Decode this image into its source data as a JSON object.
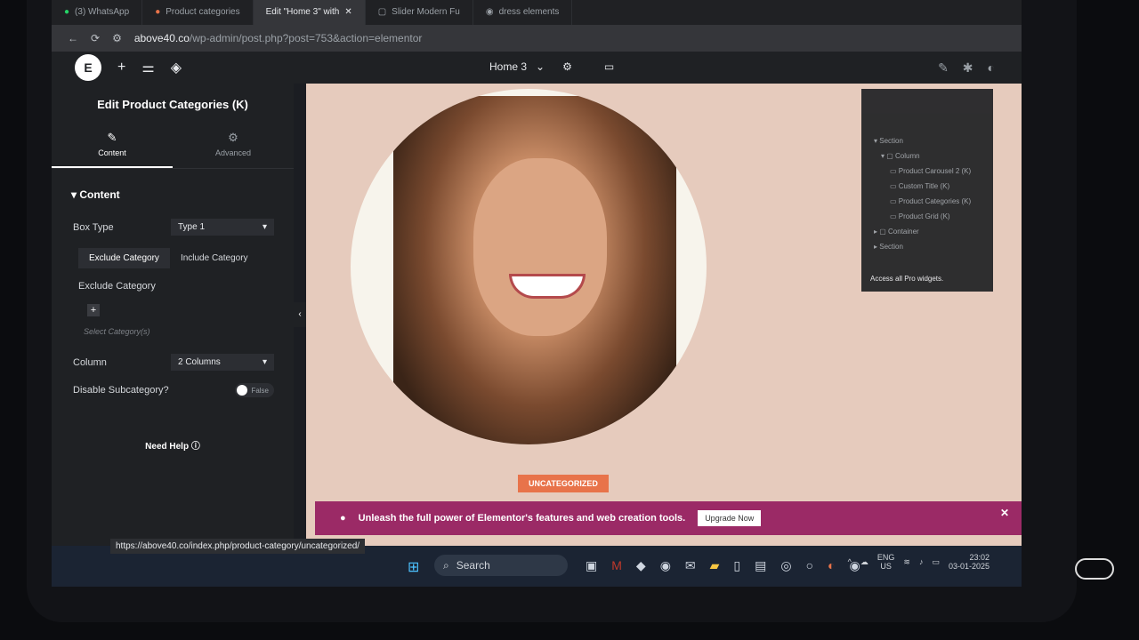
{
  "browser": {
    "tabs": [
      {
        "label": "(3) WhatsApp",
        "icon": "whatsapp-icon",
        "active": false
      },
      {
        "label": "Product categories",
        "icon": "chrome-icon",
        "active": false
      },
      {
        "label": "Edit \"Home 3\" with",
        "icon": "elementor-icon",
        "active": true
      },
      {
        "label": "Slider Modern Fu",
        "icon": "page-icon",
        "active": false
      },
      {
        "label": "dress elements",
        "icon": "google-icon",
        "active": false
      }
    ],
    "url_host": "above40.co",
    "url_path": "/wp-admin/post.php?post=753&action=elementor"
  },
  "topbar": {
    "page_name": "Home 3"
  },
  "panel": {
    "title": "Edit Product Categories (K)",
    "tab_content": "Content",
    "tab_advanced": "Advanced",
    "section": "Content",
    "box_type_label": "Box Type",
    "box_type_value": "Type 1",
    "exclude_btn": "Exclude Category",
    "include_btn": "Include Category",
    "exclude_label": "Exclude Category",
    "select_placeholder": "Select Category(s)",
    "column_label": "Column",
    "column_value": "2 Columns",
    "subcat_label": "Disable Subcategory?",
    "subcat_value": "False",
    "need_help": "Need Help"
  },
  "canvas": {
    "badge": "UNCATEGORIZED",
    "promo_text": "Unleash the full power of Elementor's features and web creation tools.",
    "upgrade_btn": "Upgrade Now"
  },
  "navigator": {
    "items": [
      "Section",
      "Column",
      "Product Carousel 2 (K)",
      "Custom Title (K)",
      "Product Categories (K)",
      "Product Grid (K)",
      "Container",
      "Section"
    ],
    "pro_text": "Access all Pro widgets."
  },
  "status_url": "https://above40.co/index.php/product-category/uncategorized/",
  "taskbar": {
    "search": "Search",
    "lang1": "ENG",
    "lang2": "US",
    "time": "23:02",
    "date": "03-01-2025"
  }
}
